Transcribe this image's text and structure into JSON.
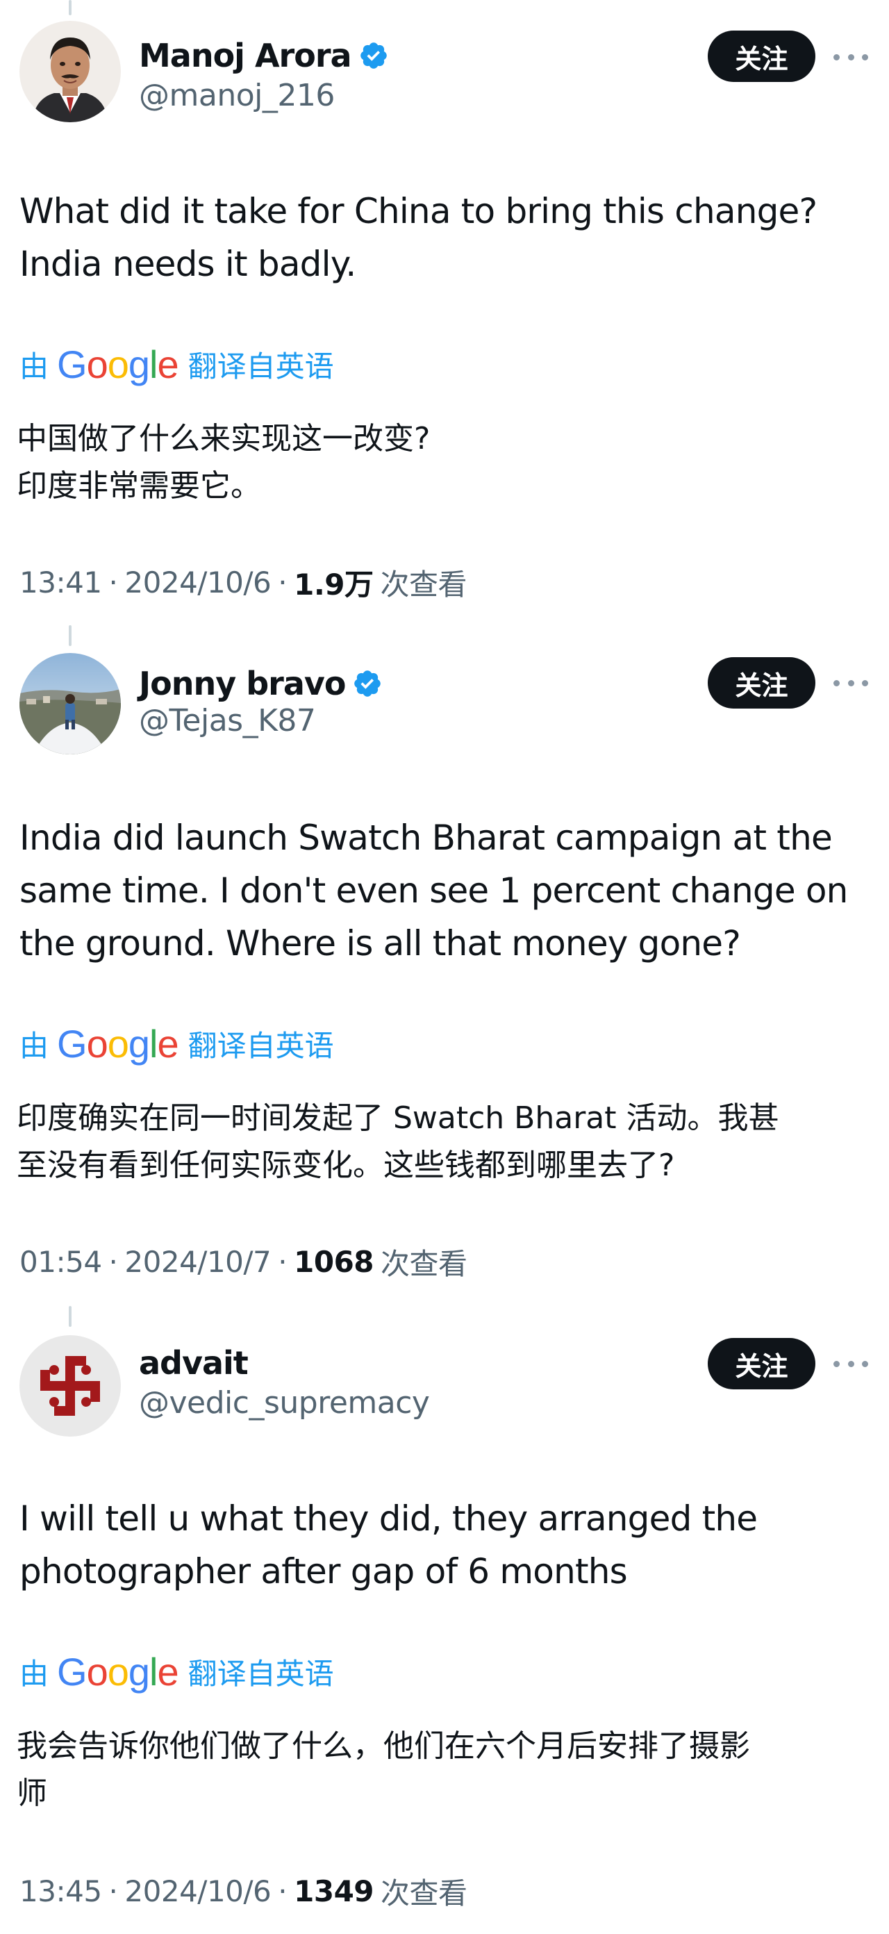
{
  "ui": {
    "follow_label": "关注",
    "translate_prefix": "由",
    "translate_suffix": "翻译自英语",
    "google_letters": [
      {
        "ch": "G",
        "color": "#4285F4"
      },
      {
        "ch": "o",
        "color": "#EA4335"
      },
      {
        "ch": "o",
        "color": "#FBBC05"
      },
      {
        "ch": "g",
        "color": "#4285F4"
      },
      {
        "ch": "l",
        "color": "#34A853"
      },
      {
        "ch": "e",
        "color": "#EA4335"
      }
    ],
    "views_label": "次查看",
    "separator": "·",
    "colors": {
      "link_blue": "#1d9bf0",
      "verified_blue": "#1d9bf0",
      "text_primary": "#0f1419",
      "text_secondary": "#536471",
      "follow_bg": "#0f1419",
      "thread_line": "#cfd9de"
    },
    "icons": [
      "verified-badge-icon",
      "more-options-icon"
    ]
  },
  "tweets": [
    {
      "display_name": "Manoj Arora",
      "verified": true,
      "handle": "@manoj_216",
      "text": "What did it take for China to bring this change?\nIndia needs it badly.",
      "translation": "中国做了什么来实现这一改变?\n印度非常需要它。",
      "time": "13:41",
      "date": "2024/10/6",
      "views": "1.9万"
    },
    {
      "display_name": "Jonny bravo",
      "verified": true,
      "handle": "@Tejas_K87",
      "text": "India did launch Swatch Bharat campaign at the\nsame time. I don't even see 1 percent change on\nthe ground. Where is all that money gone?",
      "translation": "印度确实在同一时间发起了 Swatch Bharat 活动。我甚\n至没有看到任何实际变化。这些钱都到哪里去了?",
      "time": "01:54",
      "date": "2024/10/7",
      "views": "1068"
    },
    {
      "display_name": "advait",
      "verified": false,
      "handle": "@vedic_supremacy",
      "text": "I will tell u what they did, they arranged the\nphotographer after gap of 6 months",
      "translation": "我会告诉你他们做了什么，他们在六个月后安排了摄影\n师",
      "time": "13:45",
      "date": "2024/10/6",
      "views": "1349"
    }
  ]
}
